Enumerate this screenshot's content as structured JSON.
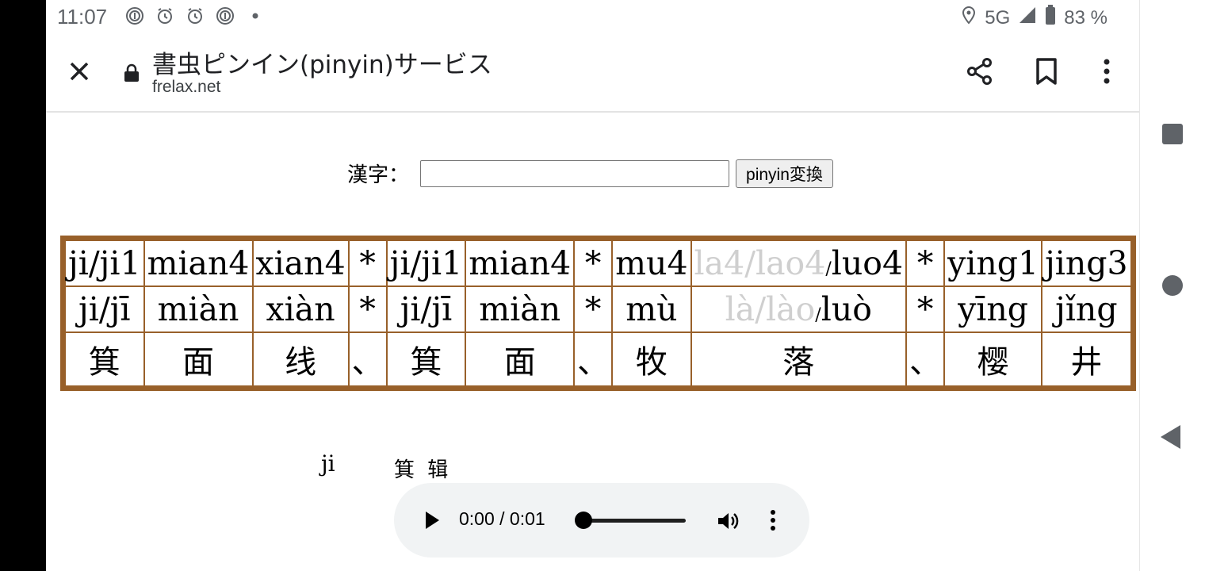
{
  "status_bar": {
    "time": "11:07",
    "network": "5G",
    "battery": "83 %"
  },
  "toolbar": {
    "title": "書虫ピンイン(pinyin)サービス",
    "domain": "frelax.net"
  },
  "form": {
    "label": "漢字：",
    "input_value": "",
    "button_label": "pinyin変換"
  },
  "table": {
    "columns": [
      {
        "tone": "ji/ji1",
        "pinyin": "ji/jī",
        "hanzi": "箕"
      },
      {
        "tone": "mian4",
        "pinyin": "miàn",
        "hanzi": "面"
      },
      {
        "tone": "xian4",
        "pinyin": "xiàn",
        "hanzi": "线"
      },
      {
        "tone": "*",
        "pinyin": "*",
        "hanzi": "、"
      },
      {
        "tone": "ji/ji1",
        "pinyin": "ji/jī",
        "hanzi": "箕"
      },
      {
        "tone": "mian4",
        "pinyin": "miàn",
        "hanzi": "面"
      },
      {
        "tone": "*",
        "pinyin": "*",
        "hanzi": "、"
      },
      {
        "tone": "mu4",
        "pinyin": "mù",
        "hanzi": "牧"
      },
      {
        "tone_faded": "la4/lao4",
        "tone_main": "luo4",
        "pinyin_faded": "là/lào",
        "pinyin_main": "luò",
        "hanzi": "落"
      },
      {
        "tone": "*",
        "pinyin": "*",
        "hanzi": "、"
      },
      {
        "tone": "ying1",
        "pinyin": "yīng",
        "hanzi": "樱"
      },
      {
        "tone": "jing3",
        "pinyin": "jǐng",
        "hanzi": "井"
      }
    ]
  },
  "entry": {
    "pinyin": "ji",
    "chars": "箕 辑"
  },
  "audio": {
    "time": "0:00 / 0:01",
    "progress": 0
  }
}
